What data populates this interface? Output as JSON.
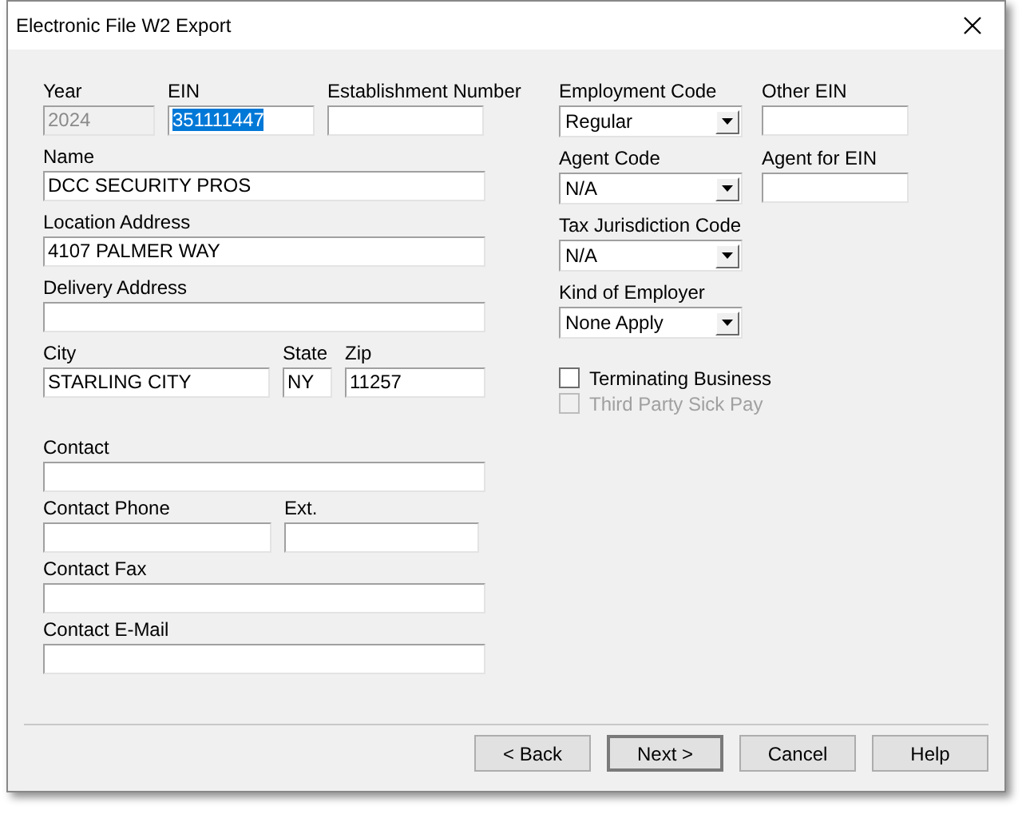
{
  "window": {
    "title": "Electronic File W2 Export"
  },
  "left_rows": [
    [
      {
        "label": "Year",
        "value": "2024",
        "disabled": true,
        "highlighted": false
      },
      {
        "label": "EIN",
        "value": "351111447",
        "disabled": false,
        "highlighted": true
      },
      {
        "label": "Establishment Number",
        "disabled": false
      }
    ],
    [
      {
        "label": "Name",
        "value": "DCC SECURITY PROS",
        "disabled": false,
        "highlighted": false
      }
    ],
    [
      {
        "label": "Location Address",
        "value": "4107 PALMER WAY",
        "disabled": false,
        "highlighted": false
      }
    ],
    [
      {
        "label": "Delivery Address",
        "disabled": false
      }
    ],
    [
      {
        "label": "City",
        "value": "STARLING CITY",
        "disabled": false,
        "highlighted": false
      },
      {
        "label": "State",
        "value": "NY",
        "disabled": false,
        "highlighted": false
      },
      {
        "label": "Zip",
        "value": "11257",
        "disabled": false,
        "highlighted": false
      }
    ]
  ],
  "contact_rows": [
    [
      {
        "label": "Contact",
        "disabled": false
      }
    ],
    [
      {
        "label": "Contact Phone",
        "disabled": false
      },
      {
        "label": "Ext.",
        "disabled": false
      }
    ],
    [
      {
        "label": "Contact Fax",
        "disabled": false
      }
    ],
    [
      {
        "label": "Contact E-Mail",
        "disabled": false
      }
    ]
  ],
  "right_rows": [
    [
      {
        "kind": "select",
        "label": "Employment Code",
        "value": "Regular"
      },
      {
        "kind": "text",
        "label": "Other EIN"
      }
    ],
    [
      {
        "kind": "select",
        "label": "Agent Code",
        "value": "N/A"
      },
      {
        "kind": "text",
        "label": "Agent for EIN"
      }
    ],
    [
      {
        "kind": "select",
        "label": "Tax Jurisdiction Code",
        "value": "N/A"
      }
    ],
    [
      {
        "kind": "select",
        "label": "Kind of Employer",
        "value": "None Apply"
      }
    ]
  ],
  "checkboxes": [
    {
      "label": "Terminating Business",
      "checked": false,
      "disabled": false
    },
    {
      "label": "Third Party Sick Pay",
      "checked": false,
      "disabled": true
    }
  ],
  "buttons": [
    {
      "label": "< Back",
      "default": false
    },
    {
      "label": "Next >",
      "default": true
    },
    {
      "label": "Cancel",
      "default": false
    },
    {
      "label": "Help",
      "default": false
    }
  ]
}
